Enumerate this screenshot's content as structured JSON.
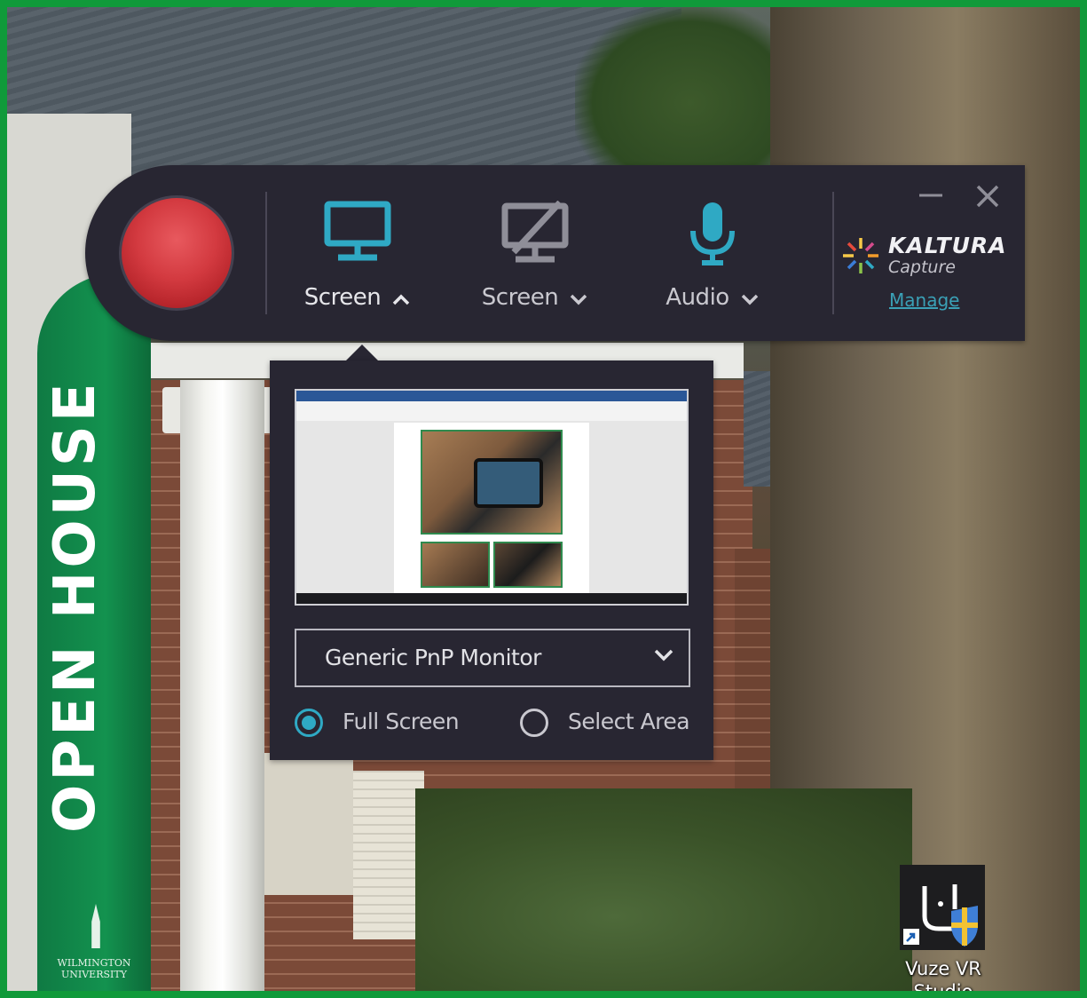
{
  "wallpaper": {
    "banner_text": "OPEN HOUSE",
    "banner_subtext": "WILMINGTON UNIVERSITY"
  },
  "desktop_icon": {
    "label": "Vuze VR Studio",
    "icon": "vuze-vr-studio-icon"
  },
  "toolbar": {
    "record_icon": "record-icon",
    "tools": [
      {
        "label": "Screen",
        "icon": "monitor-icon",
        "chevron": "chevron-up-icon",
        "active": true
      },
      {
        "label": "Screen",
        "icon": "monitor-off-icon",
        "chevron": "chevron-down-icon",
        "active": false
      },
      {
        "label": "Audio",
        "icon": "microphone-icon",
        "chevron": "chevron-down-icon",
        "active": false
      }
    ],
    "brand_name": "KALTURA",
    "brand_sub": "Capture",
    "manage_link": "Manage",
    "accent_color": "#2fa9c4",
    "record_color": "#d33a40"
  },
  "screen_panel": {
    "monitor_select": {
      "value": "Generic PnP Monitor"
    },
    "options": [
      {
        "label": "Full Screen",
        "selected": true
      },
      {
        "label": "Select Area",
        "selected": false
      }
    ]
  }
}
